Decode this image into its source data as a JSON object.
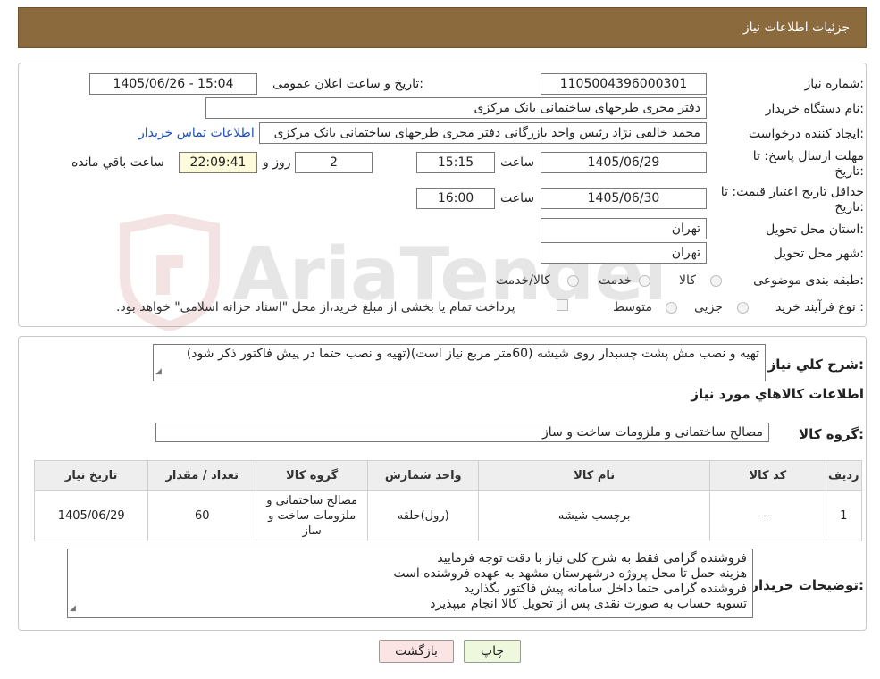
{
  "header": {
    "title": "جزئیات اطلاعات نیاز"
  },
  "form": {
    "need_number_label": "شماره نیاز:",
    "need_number": "1105004396000301",
    "announce_label": "تاریخ و ساعت اعلان عمومی:",
    "announce_value": "1405/06/26 - 15:04",
    "buyer_org_label": "نام دستگاه خریدار:",
    "buyer_org": "دفتر مجری طرحهای ساختمانی بانک مرکزی",
    "requester_label": "ایجاد کننده درخواست:",
    "requester": "محمد خالقی نژاد رئیس واحد بازرگانی دفتر مجری طرحهای ساختمانی بانک مرکزی",
    "contact_link": "اطلاعات تماس خریدار",
    "reply_deadline_label_1": "مهلت ارسال پاسخ: تا",
    "reply_deadline_label_2": "تاریخ:",
    "reply_date": "1405/06/29",
    "time_label": "ساعت",
    "reply_time": "15:15",
    "days_value": "2",
    "days_label": "روز و",
    "remaining_time": "22:09:41",
    "remaining_label": "ساعت باقي مانده",
    "price_validity_label_1": "حداقل تاریخ اعتبار قیمت: تا",
    "price_validity_label_2": "تاریخ:",
    "price_date": "1405/06/30",
    "price_time_label": "ساعت",
    "price_time": "16:00",
    "province_label": "استان محل تحویل:",
    "province": "تهران",
    "city_label": "شهر محل تحویل:",
    "city": "تهران",
    "category_label": "طبقه بندی موضوعی:",
    "category_options": [
      "کالا",
      "خدمت",
      "کالا/خدمت"
    ],
    "process_label": "نوع فرآیند خرید :",
    "process_options": [
      "جزیی",
      "متوسط"
    ],
    "payment_note": "پرداخت تمام یا بخشی از مبلغ خرید،از محل \"اسناد خزانه اسلامی\" خواهد بود."
  },
  "description": {
    "label": "شرح کلي نياز:",
    "text": "تهیه و نصب مش پشت چسبدار روی شیشه (60متر مربع نیاز است)(تهیه و نصب حتما در پیش فاکتور ذکر شود)",
    "goods_info_title": "اطلاعات کالاهاي مورد نياز",
    "group_label": "گروه کالا:",
    "group_value": "مصالح ساختمانی و ملزومات ساخت و ساز"
  },
  "table": {
    "headers": [
      "ردیف",
      "کد کالا",
      "نام کالا",
      "واحد شمارش",
      "گروه کالا",
      "تعداد / مقدار",
      "تاریخ نیاز"
    ],
    "rows": [
      [
        "1",
        "--",
        "برچسب شیشه",
        "(رول)حلقه",
        "مصالح ساختمانی و ملزومات ساخت و ساز",
        "60",
        "1405/06/29"
      ]
    ]
  },
  "buyer_notes": {
    "label": "توضیحات خریدار:",
    "lines": [
      "فروشنده گرامی فقط به شرح کلی نیاز  با دقت توجه فرمایید",
      "هزینه حمل تا محل پروژه درشهرستان مشهد به عهده فروشنده است",
      "فروشنده گرامی حتما داخل سامانه پیش فاکتور بگذارید",
      "تسویه حساب به صورت نقدی پس از تحویل کالا  انجام میپذیرد"
    ]
  },
  "buttons": {
    "print": "چاپ",
    "back": "بازگشت"
  },
  "watermark": {
    "text": "AriaTender.neT"
  },
  "colors": {
    "header_bg": "#8b6a3e",
    "print_bg": "#eef8dc",
    "back_bg": "#fbe4e4",
    "link": "#1a4fc4"
  }
}
